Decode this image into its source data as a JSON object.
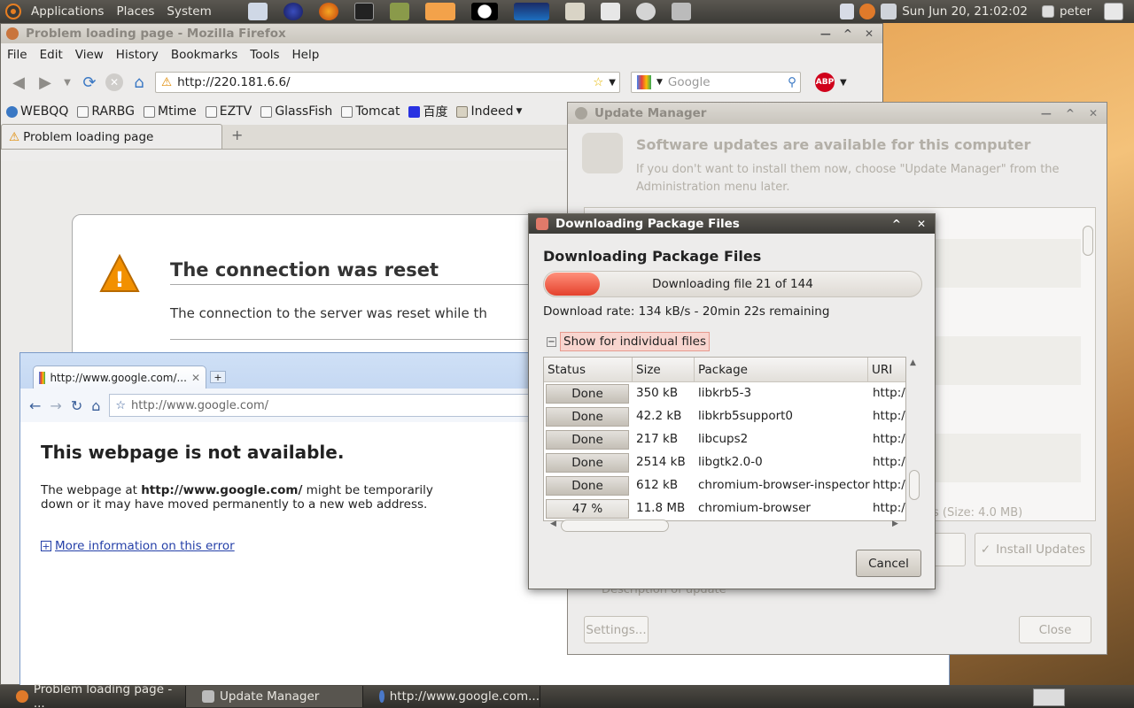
{
  "top_panel": {
    "menus": [
      "Applications",
      "Places",
      "System"
    ],
    "clock": "Sun Jun 20, 21:02:02",
    "user": "peter"
  },
  "firefox": {
    "title": "Problem loading page - Mozilla Firefox",
    "menus": [
      "File",
      "Edit",
      "View",
      "History",
      "Bookmarks",
      "Tools",
      "Help"
    ],
    "url": "http://220.181.6.6/",
    "search_placeholder": "Google",
    "bookmarks": [
      "WEBQQ",
      "RARBG",
      "Mtime",
      "EZTV",
      "GlassFish",
      "Tomcat",
      "百度",
      "Indeed"
    ],
    "tab_title": "Problem loading page",
    "error_title": "The connection was reset",
    "error_text": "The connection to the server was reset while th"
  },
  "chrome": {
    "tab_title": "http://www.google.com/...",
    "url": "http://www.google.com/",
    "heading": "This webpage is not available.",
    "body_prefix": "The webpage at ",
    "body_link": "http://www.google.com/",
    "body_suffix": " might be temporarily",
    "body_line2": "down or it may have moved permanently to a new web address.",
    "more_info": "More information on this error"
  },
  "update_manager": {
    "title": "Update Manager",
    "heading": "Software updates are available for this computer",
    "subtext_line1": "If you don't want to install them now, choose \"Update Manager\" from the",
    "subtext_line2": "Administration menu later.",
    "size_text": "es (Size: 4.0 MB)",
    "description_label": "Description of update",
    "settings_button": "Settings...",
    "install_button": "Install Updates",
    "close_button": "Close"
  },
  "download_dialog": {
    "title": "Downloading Package Files",
    "heading": "Downloading Package Files",
    "progress_label": "Downloading file 21 of 144",
    "progress_fraction": 0.146,
    "rate_text": "Download rate: 134 kB/s - 20min 22s remaining",
    "expander_label": "Show for individual files",
    "columns": [
      "Status",
      "Size",
      "Package",
      "URI"
    ],
    "rows": [
      {
        "status": "Done",
        "size": "350 kB",
        "package": "libkrb5-3",
        "uri": "http:/"
      },
      {
        "status": "Done",
        "size": "42.2 kB",
        "package": "libkrb5support0",
        "uri": "http:/"
      },
      {
        "status": "Done",
        "size": "217 kB",
        "package": "libcups2",
        "uri": "http:/"
      },
      {
        "status": "Done",
        "size": "2514 kB",
        "package": "libgtk2.0-0",
        "uri": "http:/"
      },
      {
        "status": "Done",
        "size": "612 kB",
        "package": "chromium-browser-inspector",
        "uri": "http:/"
      },
      {
        "status": "47 %",
        "size": "11.8 MB",
        "package": "chromium-browser",
        "uri": "http:/"
      }
    ],
    "cancel_button": "Cancel"
  },
  "taskbar": {
    "items": [
      "Problem loading page - ...",
      "Update Manager",
      "http://www.google.com..."
    ]
  },
  "colors": {
    "progress_fill": "#e4412c",
    "panel_bg": "#3c3b37",
    "error_icon": "#f29000"
  }
}
